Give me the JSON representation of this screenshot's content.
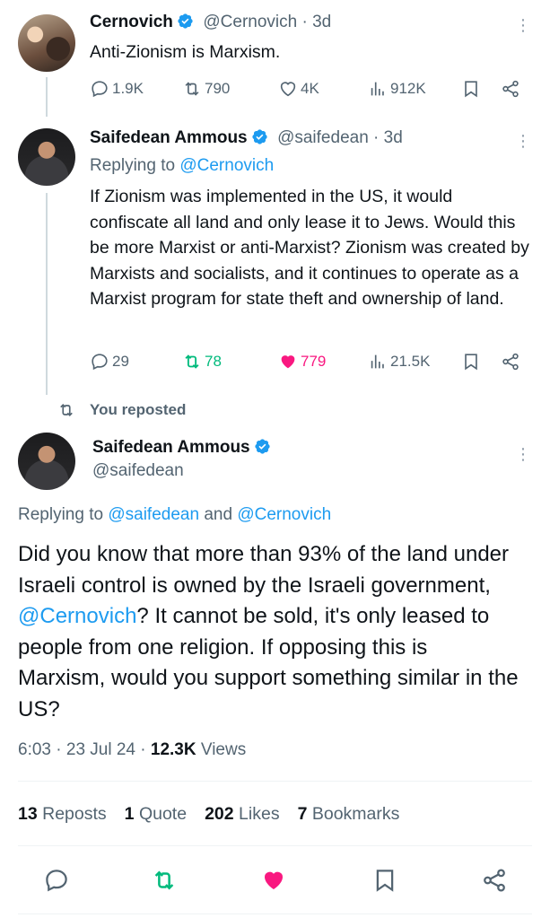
{
  "tweet1": {
    "name": "Cernovich",
    "handle": "@Cernovich",
    "time": "3d",
    "text": "Anti-Zionism is Marxism.",
    "replies": "1.9K",
    "reposts": "790",
    "likes": "4K",
    "views": "912K"
  },
  "tweet2": {
    "name": "Saifedean Ammous",
    "handle": "@saifedean",
    "time": "3d",
    "replying_prefix": "Replying to ",
    "replying_to": "@Cernovich",
    "text": "If Zionism was implemented in the US, it would confiscate all land and only lease it to Jews. Would this be more Marxist or anti-Marxist? Zionism was created by Marxists and socialists, and it continues to operate as a Marxist program for state theft and ownership of land.",
    "replies": "29",
    "reposts": "78",
    "likes": "779",
    "views": "21.5K"
  },
  "repost_banner": "You reposted",
  "main_tweet": {
    "name": "Saifedean Ammous",
    "handle": "@saifedean",
    "replying_prefix": "Replying to ",
    "replying_to_1": "@saifedean",
    "replying_and": " and ",
    "replying_to_2": "@Cernovich",
    "text_part1": "Did you know that more than 93% of the land under Israeli control is owned by the Israeli government, ",
    "text_mention": "@Cernovich",
    "text_part2": "? It cannot be sold, it's only leased to people from one religion. If opposing this is Marxism, would you support something similar in the US?",
    "time": "6:03",
    "date": "23 Jul 24",
    "views_count": "12.3K",
    "views_label": "Views"
  },
  "stats": {
    "reposts_count": "13",
    "reposts_label": "Reposts",
    "quotes_count": "1",
    "quotes_label": "Quote",
    "likes_count": "202",
    "likes_label": "Likes",
    "bookmarks_count": "7",
    "bookmarks_label": "Bookmarks"
  },
  "colors": {
    "accent": "#1d9bf0",
    "repost_green": "#00ba7c",
    "like_pink": "#f91880",
    "secondary_text": "#536471"
  },
  "icons": [
    "reply-icon",
    "repost-icon",
    "like-icon",
    "views-icon",
    "bookmark-icon",
    "share-icon",
    "verified-icon",
    "more-icon"
  ]
}
